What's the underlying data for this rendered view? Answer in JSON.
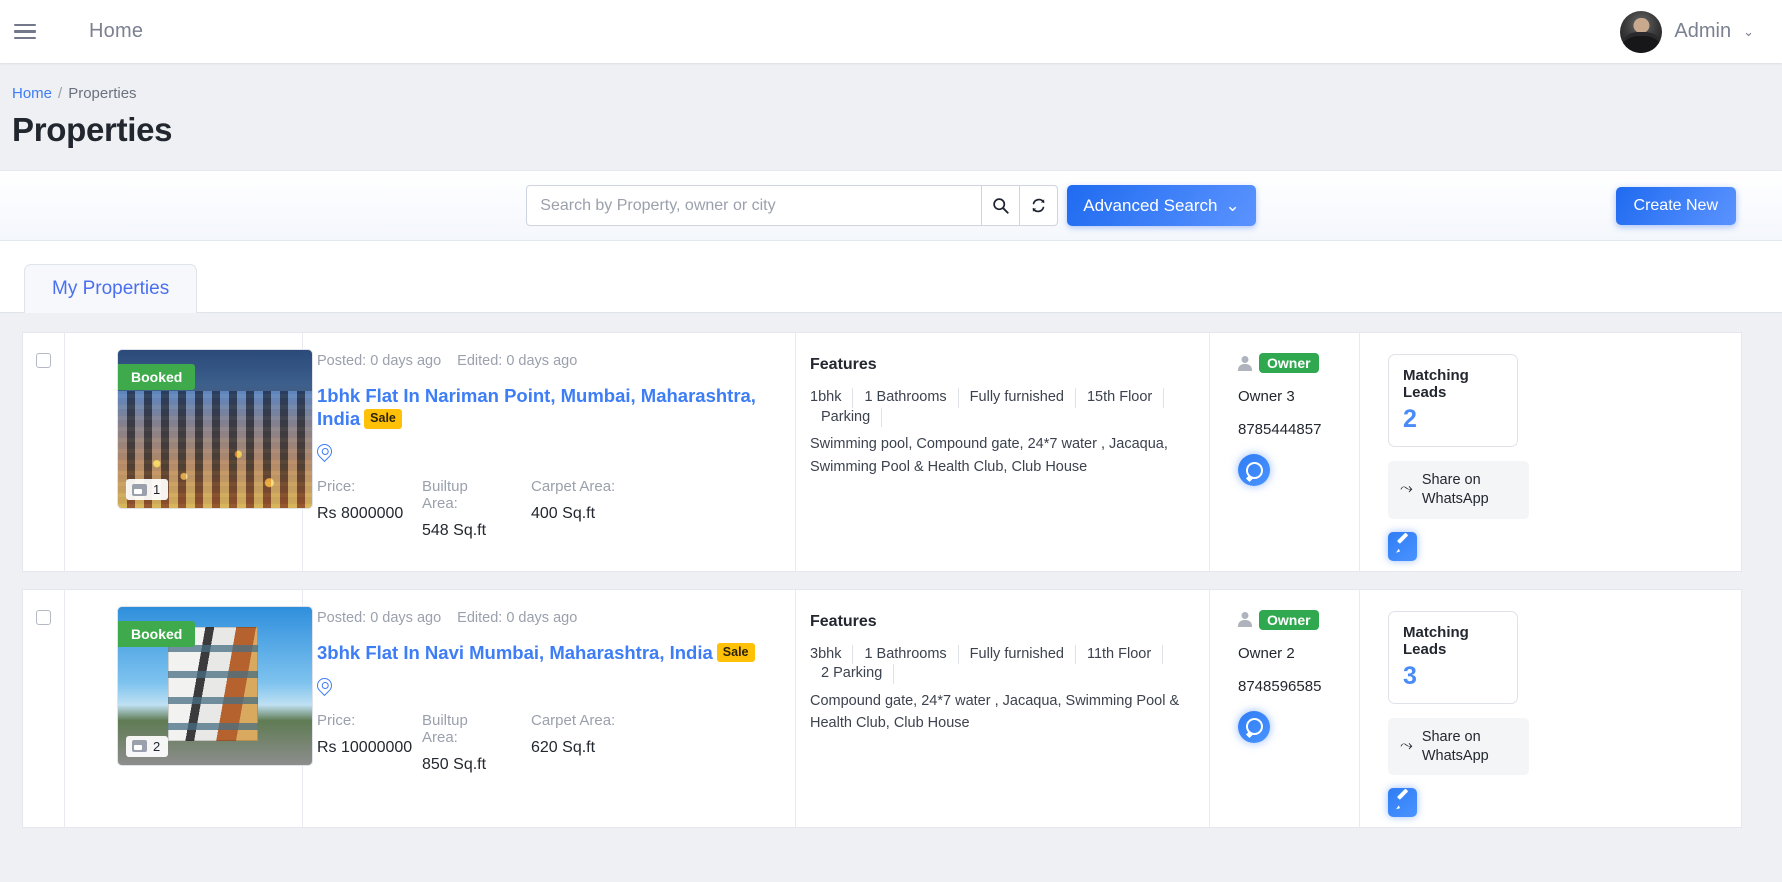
{
  "topbar": {
    "menu_icon": "hamburger-icon",
    "home_label": "Home",
    "user_name": "Admin",
    "caret": "⌄"
  },
  "breadcrumb": {
    "home": "Home",
    "separator": "/",
    "current": "Properties"
  },
  "page_title": "Properties",
  "search": {
    "placeholder": "Search by Property, owner or city",
    "value": "",
    "search_icon": "search-icon",
    "refresh_icon": "refresh-icon",
    "advanced_label": "Advanced Search",
    "advanced_caret": "⌄",
    "create_label": "Create New"
  },
  "tabs": [
    {
      "label": "My Properties",
      "active": true
    }
  ],
  "labels": {
    "features": "Features",
    "price": "Price:",
    "builtup": "Builtup Area:",
    "carpet": "Carpet Area:",
    "matching_leads": "Matching Leads",
    "share_whatsapp": "Share on WhatsApp",
    "owner_badge": "Owner",
    "sale_tag": "Sale",
    "booked_tag": "Booked"
  },
  "colors": {
    "accent": "#3d7df6",
    "booked_green": "#3faa4c",
    "owner_green": "#2fa84f",
    "sale_yellow": "#ffc107",
    "page_bg": "#eef0f4"
  },
  "properties": [
    {
      "booked": "Booked",
      "image_count": "1",
      "image_kind": "city-skyline-photo",
      "posted": "Posted: 0 days ago",
      "edited": "Edited: 0 days ago",
      "title": "1bhk Flat In Nariman Point, Mumbai, Maharashtra, India",
      "sale": "Sale",
      "price": "Rs 8000000",
      "builtup": "548 Sq.ft",
      "carpet": "400 Sq.ft",
      "chips": [
        "1bhk",
        "1  Bathrooms",
        "Fully furnished",
        "15th Floor",
        "Parking"
      ],
      "amenities": "Swimming pool, Compound gate, 24*7 water , Jacaqua, Swimming Pool & Health Club, Club House",
      "owner_badge": "Owner",
      "owner_name": "Owner 3",
      "owner_phone": "8785444857",
      "matching_leads": "2"
    },
    {
      "booked": "Booked",
      "image_count": "2",
      "image_kind": "apartment-building-photo",
      "posted": "Posted: 0 days ago",
      "edited": "Edited: 0 days ago",
      "title": "3bhk Flat In Navi Mumbai, Maharashtra, India",
      "sale": "Sale",
      "price": "Rs 10000000",
      "builtup": "850 Sq.ft",
      "carpet": "620 Sq.ft",
      "chips": [
        "3bhk",
        "1  Bathrooms",
        "Fully furnished",
        "11th Floor",
        "2  Parking"
      ],
      "amenities": "Compound gate, 24*7 water , Jacaqua, Swimming Pool & Health Club, Club House",
      "owner_badge": "Owner",
      "owner_name": "Owner 2",
      "owner_phone": "8748596585",
      "matching_leads": "3"
    }
  ]
}
